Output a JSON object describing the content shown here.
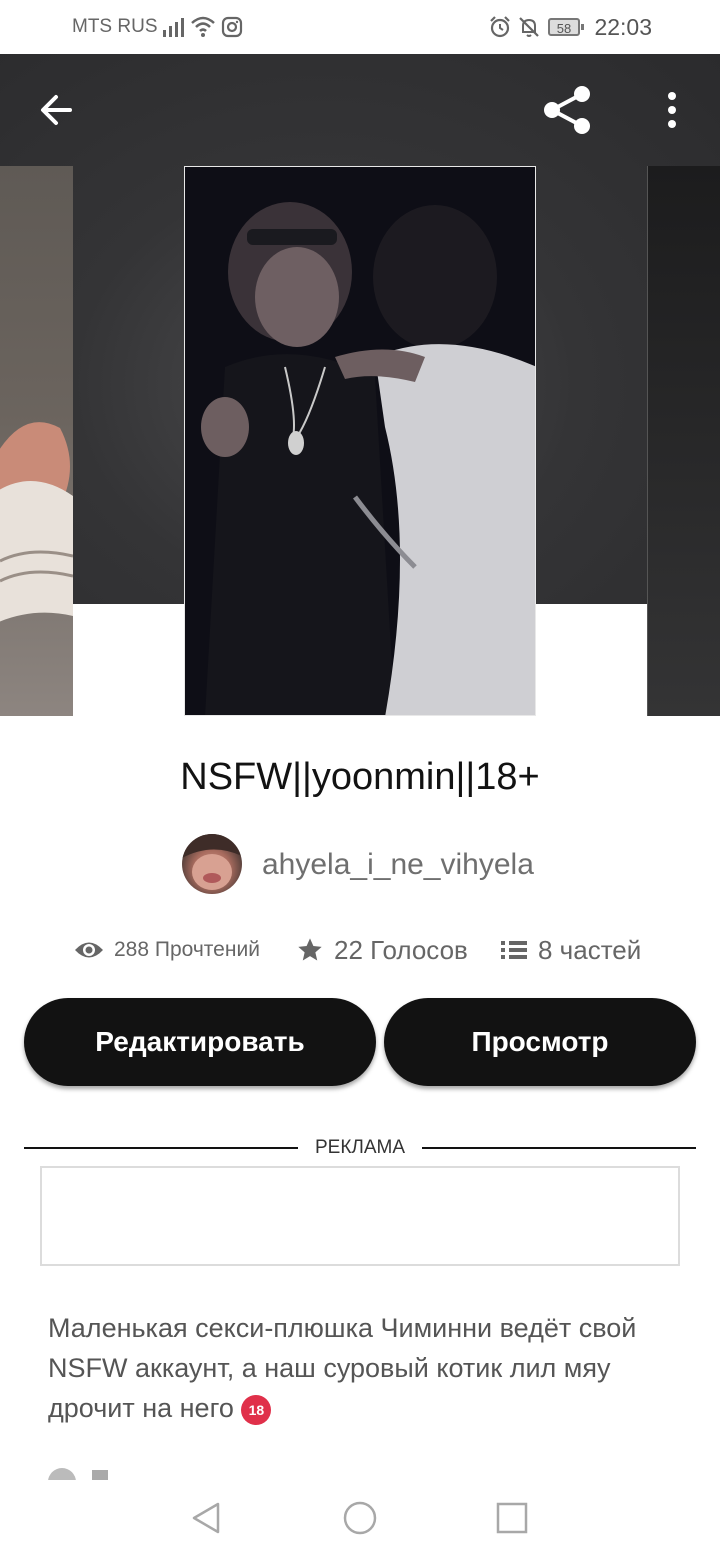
{
  "status_bar": {
    "carrier": "MTS RUS",
    "battery": "58",
    "time": "22:03",
    "icons": [
      "signal-icon",
      "wifi-icon",
      "instagram-icon",
      "alarm-icon",
      "bell-off-icon",
      "battery-icon"
    ]
  },
  "toolbar": {
    "icons": [
      "back-arrow-icon",
      "share-icon",
      "more-vert-icon"
    ]
  },
  "story": {
    "title": "NSFW||yoonmin||18+",
    "author": "ahyela_i_ne_vihyela",
    "reads": "288 Прочтений",
    "votes": "22 Голосов",
    "parts": "8 частей"
  },
  "actions": {
    "edit_label": "Редактировать",
    "preview_label": "Просмотр"
  },
  "ad": {
    "label": "РЕКЛАМА"
  },
  "description": {
    "text": "Маленькая секси-плюшка Чиминни ведёт свой NSFW аккаунт, а наш суровый котик лил мяу дрочит на него",
    "badge": "18"
  },
  "nav_bar": {
    "icons": [
      "nav-back-icon",
      "nav-home-icon",
      "nav-recents-icon"
    ]
  },
  "colors": {
    "button_bg": "#121212",
    "hero_bg": "#343436",
    "badge_red": "#e0304a"
  }
}
